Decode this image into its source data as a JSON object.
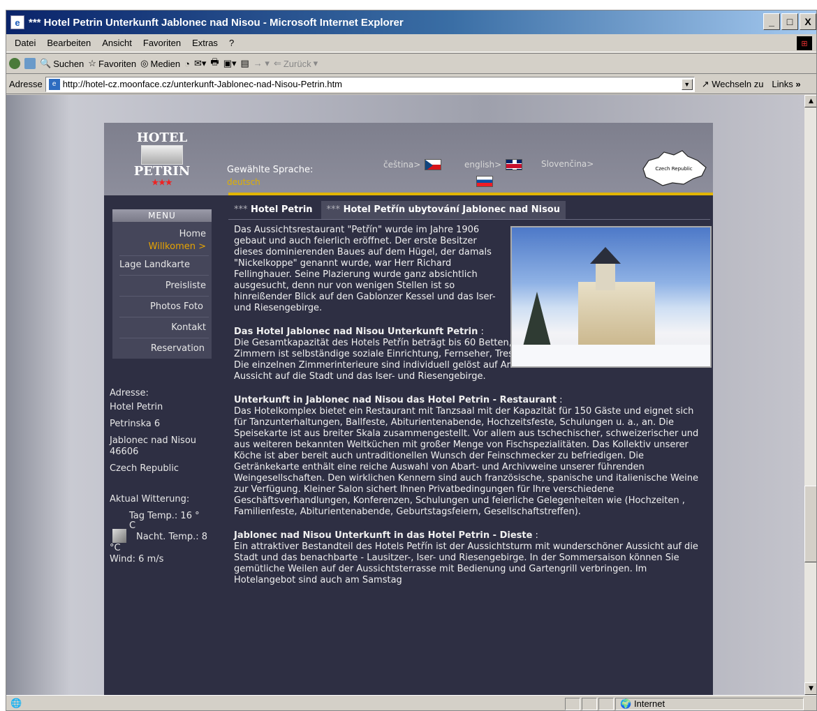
{
  "window": {
    "title": "*** Hotel Petrin Unterkunft Jablonec nad Nisou - Microsoft Internet Explorer",
    "controls": [
      "_",
      "□",
      "X"
    ]
  },
  "menubar": [
    "Datei",
    "Bearbeiten",
    "Ansicht",
    "Favoriten",
    "Extras",
    "?"
  ],
  "toolbar": {
    "search": "Suchen",
    "favorites": "Favoriten",
    "media": "Medien",
    "back": "Zurück"
  },
  "address": {
    "label": "Adresse",
    "url": "http://hotel-cz.moonface.cz/unterkunft-Jablonec-nad-Nisou-Petrin.htm",
    "go": "Wechseln zu",
    "links": "Links"
  },
  "status": {
    "zone": "Internet"
  },
  "header": {
    "logo_top": "HOTEL",
    "logo_bottom": "PETRIN",
    "logo_stars": "★★★",
    "selected_language_label": "Gewählte Sprache:",
    "selected_language_value": "deutsch",
    "languages": [
      "čeština>",
      "english>",
      "Slovenčina>"
    ],
    "map_label": "Czech Republic"
  },
  "menu": {
    "heading": "MENU",
    "items": [
      "Home",
      "Willkomen  >",
      "Lage Landkarte",
      "Preisliste",
      "Photos Foto",
      "Kontakt",
      "Reservation"
    ]
  },
  "address_block": {
    "label": "Adresse:",
    "name": "Hotel Petrin",
    "street": "Petrinska 6",
    "city": "Jablonec nad Nisou",
    "zip": "46606",
    "country": "Czech Republic"
  },
  "weather": {
    "label": "Aktual Witterung:",
    "day": "Tag Temp.: 16 °",
    "day_unit": "C",
    "night": "Nacht. Temp.: 8",
    "night_unit": "°C",
    "wind": "Wind: 6 m/s"
  },
  "tabs": {
    "t1_stars": "***",
    "t1_label": "Hotel Petrin",
    "t2_stars": "***",
    "t2_label": "Hotel Petřín ubytování Jablonec nad Nisou"
  },
  "content": {
    "intro": "Das Aussichtsrestaurant \"Petřín\" wurde im Jahre 1906 gebaut und auch feierlich eröffnet. Der erste Besitzer dieses dominierenden Baues auf dem Hügel, der damals \"Nickelkoppe\" genannt wurde, war Herr Richard Fellinghauer. Seine Plazierung wurde ganz absichtlich ausgesucht, denn nur von wenigen Stellen ist so hinreißender Blick auf den Gablonzer Kessel und das Iser- und Riesengebirge.",
    "s1_title": "Das Hotel Jablonec nad Nisou Unterkunft Petrin",
    "s1_suffix": " :",
    "s1_text": "Die Gesamtkapazität des Hotels Petřín beträgt bis 60 Betten, in 23 Zimmern. In jedem von den Zimmern ist selbständige soziale Einrichtung, Fernseher, Tresor und Telefon dem Gast zur Verfügung. Die einzelnen Zimmerinterieure sind individuell gelöst auf Art der Bodeneinbauen mit herrlicher Aussicht auf die Stadt und das Iser- und Riesengebirge.",
    "s2_title": "Unterkunft in Jablonec nad Nisou das Hotel Petrin - Restaurant",
    "s2_suffix": " :",
    "s2_text": "Das Hotelkomplex bietet ein Restaurant mit Tanzsaal mit der Kapazität für 150 Gäste und eignet sich für Tanzunterhaltungen, Ballfeste, Abiturientenabende, Hochzeitsfeste, Schulungen u. a., an. Die Speisekarte ist aus breiter Skala zusammengestellt. Vor allem aus tschechischer, schweizerischer und aus weiteren bekannten Weltküchen mit großer Menge von Fischspezialitäten. Das Kollektiv unserer Köche ist aber bereit auch untraditionellen Wunsch der Feinschmecker zu befriedigen. Die Getränkekarte enthält eine reiche Auswahl von Abart- und Archivweine unserer führenden Weingesellschaften. Den wirklichen Kennern sind auch französische, spanische und italienische Weine zur Verfügung. Kleiner Salon sichert Ihnen Privatbedingungen für Ihre verschiedene Geschäftsverhandlungen, Konferenzen, Schulungen und feierliche Gelegenheiten wie (Hochzeiten , Familienfeste, Abiturientenabende, Geburtstagsfeiern, Gesellschaftstreffen).",
    "s3_title": "Jablonec nad Nisou Unterkunft in das Hotel Petrin - Dieste",
    "s3_suffix": " :",
    "s3_text": "Ein attraktiver Bestandteil des Hotels Petřín ist der Aussichtsturm mit wunderschöner Aussicht auf die Stadt und das benachbarte - Lausitzer-, Iser- und Riesengebirge. In der Sommersaison können Sie gemütliche Weilen auf der Aussichtsterrasse mit Bedienung und Gartengrill verbringen. Im Hotelangebot sind auch am Samstag"
  },
  "colors": {
    "page_bg": "#2e2f43",
    "accent_gold": "#e2b500",
    "menu_sub": "#e8a400",
    "titlebar": "#0a246a"
  }
}
